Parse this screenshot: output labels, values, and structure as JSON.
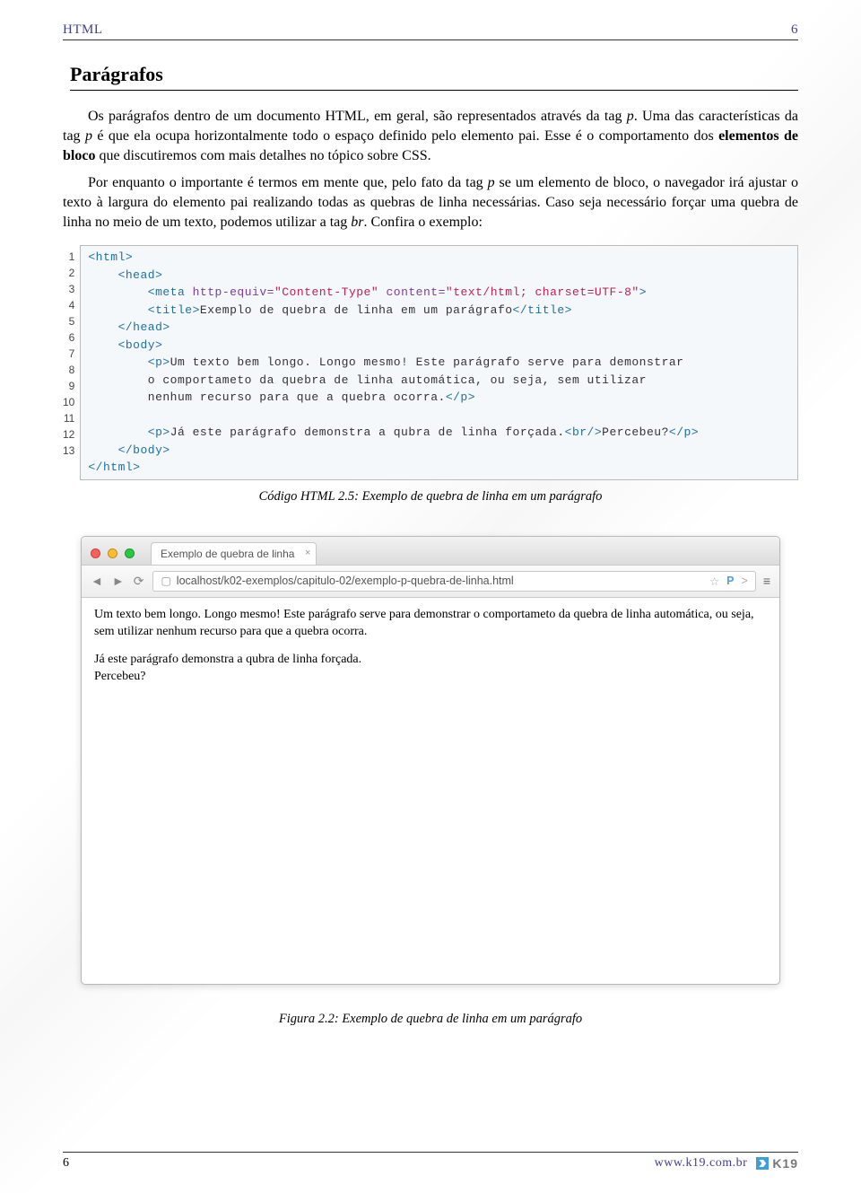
{
  "header": {
    "left": "HTML",
    "right": "6"
  },
  "section_title": "Parágrafos",
  "paragraphs": {
    "p1_a": "Os parágrafos dentro de um documento HTML, em geral, são representados através da tag ",
    "p1_tag": "p",
    "p1_b": ". Uma das características da tag ",
    "p1_tag2": "p",
    "p1_c": " é que ela ocupa horizontalmente todo o espaço definido pelo elemento pai. Esse é o comportamento dos ",
    "p1_strong": "elementos de bloco",
    "p1_d": " que discutiremos com mais detalhes no tópico sobre CSS.",
    "p2_a": "Por enquanto o importante é termos em mente que, pelo fato da tag ",
    "p2_tag": "p",
    "p2_b": " se um elemento de bloco, o navegador irá ajustar o texto à largura do elemento pai realizando todas as quebras de linha necessárias. Caso seja necessário forçar uma quebra de linha no meio de um texto, podemos utilizar a tag ",
    "p2_tag2": "br",
    "p2_c": ". Confira o exemplo:"
  },
  "code": {
    "linenos": [
      "1",
      "2",
      "3",
      "4",
      "5",
      "6",
      "7",
      "8",
      "9",
      "10",
      "11",
      "12",
      "13"
    ],
    "caption": "Código HTML 2.5: Exemplo de quebra de linha em um parágrafo"
  },
  "browser": {
    "tab_title": "Exemplo de quebra de linha",
    "url": "localhost/k02-exemplos/capitulo-02/exemplo-p-quebra-de-linha.html",
    "para1": "Um texto bem longo. Longo mesmo! Este parágrafo serve para demonstrar o comportameto da quebra de linha automática, ou seja, sem utilizar nenhum recurso para que a quebra ocorra.",
    "para2a": "Já este parágrafo demonstra a qubra de linha forçada.",
    "para2b": "Percebeu?",
    "star": "☆",
    "p_icon": "P",
    "arrow_icon": ">"
  },
  "figure_caption": "Figura 2.2: Exemplo de quebra de linha em um parágrafo",
  "footer": {
    "page_num": "6",
    "site": "www.k19.com.br",
    "brand": "K19"
  }
}
